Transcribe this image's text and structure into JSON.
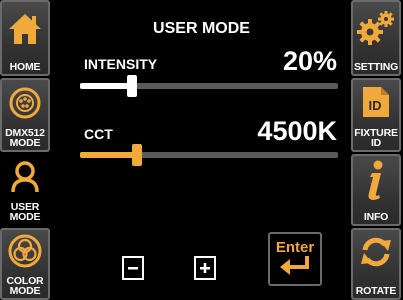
{
  "title": "USER MODE",
  "sidebar_left": [
    {
      "label": "HOME",
      "icon": "home-icon"
    },
    {
      "label": "DMX512\nMODE",
      "icon": "dmx-connector-icon"
    },
    {
      "label": "USER\nMODE",
      "icon": "user-icon"
    },
    {
      "label": "COLOR\nMODE",
      "icon": "color-circles-icon"
    }
  ],
  "sidebar_right": [
    {
      "label": "SETTING",
      "icon": "gears-icon"
    },
    {
      "label": "FIXTURE\nID",
      "icon": "id-badge-icon"
    },
    {
      "label": "INFO",
      "icon": "info-icon"
    },
    {
      "label": "ROTATE",
      "icon": "rotate-icon"
    }
  ],
  "intensity": {
    "label": "INTENSITY",
    "value": "20%",
    "level": 0.2,
    "color": "#ffffff"
  },
  "cct": {
    "label": "CCT",
    "value": "4500K",
    "level": 0.22,
    "color": "#f1a93c"
  },
  "controls": {
    "minus": "−",
    "plus": "+",
    "enter": "Enter"
  },
  "colors": {
    "accent": "#f1a93c",
    "track": "#5a5a5a"
  }
}
